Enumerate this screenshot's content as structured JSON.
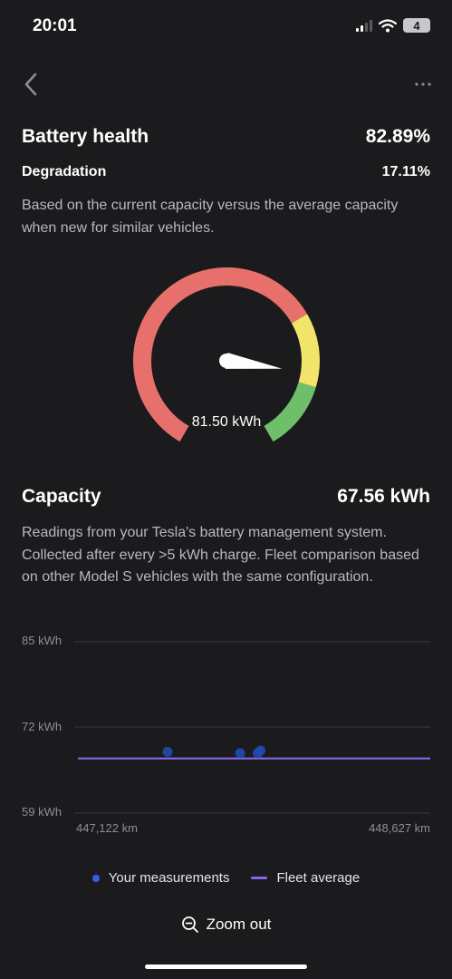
{
  "status": {
    "time": "20:01",
    "battery": "4"
  },
  "battery_health": {
    "title": "Battery health",
    "value": "82.89%",
    "degradation_label": "Degradation",
    "degradation_value": "17.11%",
    "description": "Based on the current capacity versus the average capacity when new for similar vehicles."
  },
  "gauge": {
    "label": "81.50 kWh",
    "needle_fraction": 0.83
  },
  "capacity": {
    "title": "Capacity",
    "value": "67.56 kWh",
    "description": "Readings from your Tesla's battery management system. Collected after every >5 kWh charge. Fleet comparison based on other Model S vehicles with the same configuration."
  },
  "chart_data": {
    "type": "scatter",
    "y_tick_labels": [
      "85 kWh",
      "72 kWh",
      "59 kWh"
    ],
    "x_tick_labels": [
      "447,122 km",
      "448,627 km"
    ],
    "ylim": [
      59,
      85
    ],
    "xlim": [
      447122,
      448627
    ],
    "series": [
      {
        "name": "Your measurements",
        "color": "#2f63e0",
        "type": "scatter",
        "points": [
          [
            447505,
            68.3
          ],
          [
            447815,
            68.1
          ],
          [
            447890,
            68.1
          ],
          [
            447902,
            68.5
          ]
        ]
      },
      {
        "name": "Fleet average",
        "color": "#8a63f0",
        "type": "line",
        "points": [
          [
            447122,
            67.3
          ],
          [
            448627,
            67.3
          ]
        ]
      }
    ]
  },
  "legend": {
    "measurements": "Your measurements",
    "fleet": "Fleet average"
  },
  "zoom": {
    "label": "Zoom out"
  }
}
